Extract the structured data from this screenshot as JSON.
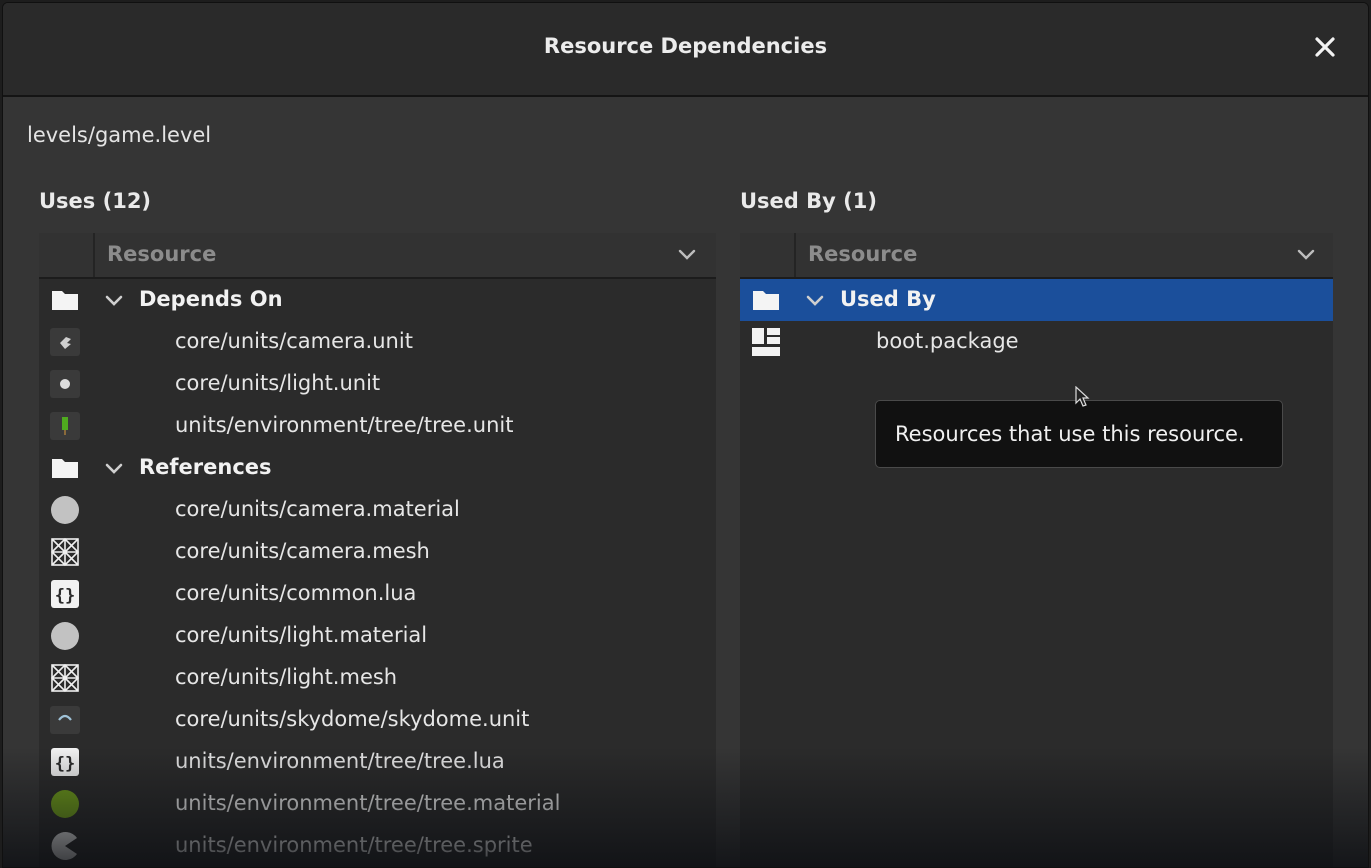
{
  "dialog": {
    "title": "Resource Dependencies",
    "resource_path": "levels/game.level"
  },
  "uses": {
    "label": "Uses (12)",
    "column_header": "Resource",
    "groups": [
      {
        "label": "Depends On",
        "icon": "folder-icon",
        "expanded": true,
        "items": [
          {
            "label": "core/units/camera.unit",
            "icon": "camera-unit-icon"
          },
          {
            "label": "core/units/light.unit",
            "icon": "light-unit-icon"
          },
          {
            "label": "units/environment/tree/tree.unit",
            "icon": "tree-unit-icon"
          }
        ]
      },
      {
        "label": "References",
        "icon": "folder-icon",
        "expanded": true,
        "items": [
          {
            "label": "core/units/camera.material",
            "icon": "material-icon"
          },
          {
            "label": "core/units/camera.mesh",
            "icon": "mesh-icon"
          },
          {
            "label": "core/units/common.lua",
            "icon": "script-icon"
          },
          {
            "label": "core/units/light.material",
            "icon": "material-icon"
          },
          {
            "label": "core/units/light.mesh",
            "icon": "mesh-icon"
          },
          {
            "label": "core/units/skydome/skydome.unit",
            "icon": "skydome-unit-icon"
          },
          {
            "label": "units/environment/tree/tree.lua",
            "icon": "script-icon"
          },
          {
            "label": "units/environment/tree/tree.material",
            "icon": "green-material-icon"
          },
          {
            "label": "units/environment/tree/tree.sprite",
            "icon": "sprite-icon"
          }
        ]
      }
    ]
  },
  "used_by": {
    "label": "Used By (1)",
    "column_header": "Resource",
    "groups": [
      {
        "label": "Used By",
        "icon": "folder-icon",
        "expanded": true,
        "selected": true,
        "items": [
          {
            "label": "boot.package",
            "icon": "package-icon"
          }
        ]
      }
    ]
  },
  "tooltip": {
    "text": "Resources that use this resource."
  },
  "colors": {
    "selection": "#1b4f9b",
    "panel_bg": "#2b2b2b",
    "dialog_bg": "#353535"
  }
}
